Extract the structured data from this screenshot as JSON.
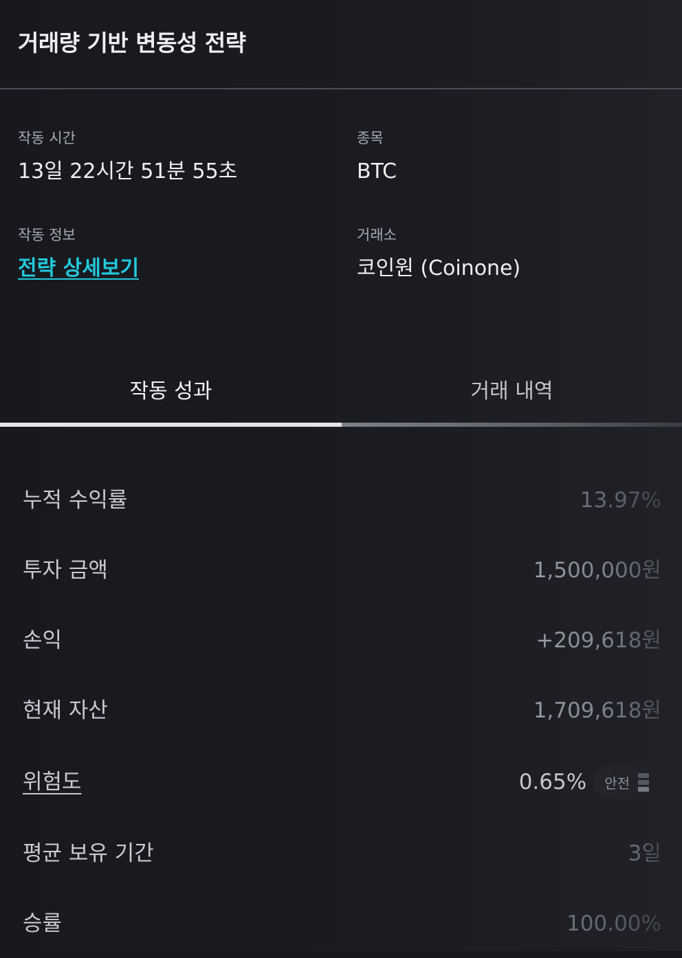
{
  "header": {
    "title": "거래량 기반 변동성 전략"
  },
  "info": {
    "run_time": {
      "label": "작동 시간",
      "value": "13일 22시간 51분 55초"
    },
    "symbol": {
      "label": "종목",
      "value": "BTC"
    },
    "run_info": {
      "label": "작동 정보",
      "link": "전략 상세보기"
    },
    "exchange": {
      "label": "거래소",
      "value": "코인원 (Coinone)"
    }
  },
  "tabs": [
    {
      "label": "작동 성과",
      "active": true
    },
    {
      "label": "거래 내역",
      "active": false
    }
  ],
  "stats": {
    "cumulative_return": {
      "label": "누적 수익률",
      "value": "13.97%"
    },
    "investment": {
      "label": "투자 금액",
      "value": "1,500,000원"
    },
    "pnl": {
      "label": "손익",
      "value": "+209,618원"
    },
    "current_assets": {
      "label": "현재 자산",
      "value": "1,709,618원"
    },
    "risk": {
      "label": "위험도",
      "value": "0.65%",
      "badge": "안전",
      "level": 1,
      "level_max": 3
    },
    "avg_holding": {
      "label": "평균 보유 기간",
      "value": "3일"
    },
    "win_rate": {
      "label": "승률",
      "value": "100.00%"
    }
  },
  "colors": {
    "background": "#17191e",
    "link": "#22c9dc",
    "text": "#eeeff2"
  },
  "icons": {
    "risk_level": "signal-bars-icon"
  }
}
